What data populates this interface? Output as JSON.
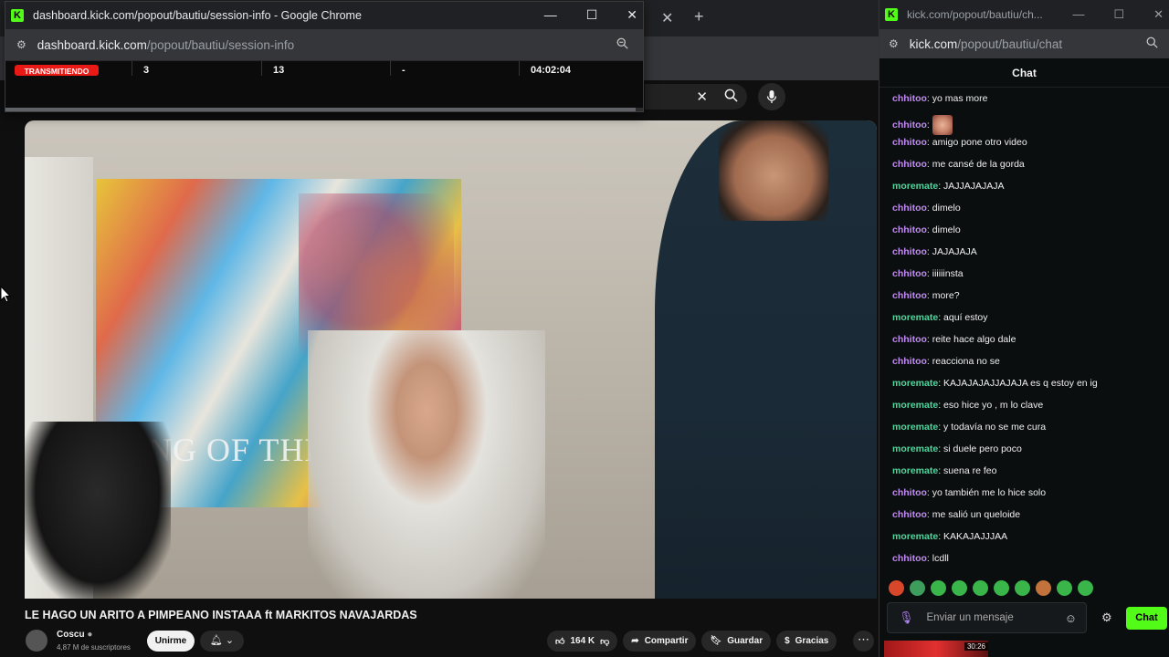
{
  "popup": {
    "title": "dashboard.kick.com/popout/bautiu/session-info - Google Chrome",
    "url_host": "dashboard.kick.com",
    "url_path": "/popout/bautiu/session-info",
    "status_badge": "TRANSMITIENDO",
    "stats": [
      "3",
      "13",
      "-",
      "04:02:04"
    ]
  },
  "chat": {
    "title": "kick.com/popout/bautiu/ch...",
    "url_host": "kick.com",
    "url_path": "/popout/bautiu/chat",
    "header": "Chat",
    "messages": [
      {
        "user": "chhitoo",
        "text": "yo mas more"
      },
      {
        "user": "chhitoo",
        "text": ""
      },
      {
        "user": "chhitoo",
        "text": "amigo pone otro video"
      },
      {
        "user": "chhitoo",
        "text": "me cansé de la gorda"
      },
      {
        "user": "moremate",
        "text": "JAJJAJAJAJA"
      },
      {
        "user": "chhitoo",
        "text": "dimelo"
      },
      {
        "user": "chhitoo",
        "text": "dimelo"
      },
      {
        "user": "chhitoo",
        "text": "JAJAJAJA"
      },
      {
        "user": "chhitoo",
        "text": "iiiiiinsta"
      },
      {
        "user": "chhitoo",
        "text": "more?"
      },
      {
        "user": "moremate",
        "text": "aquí estoy"
      },
      {
        "user": "chhitoo",
        "text": "reite hace algo dale"
      },
      {
        "user": "chhitoo",
        "text": "reacciona no se"
      },
      {
        "user": "moremate",
        "text": "KAJAJAJAJJAJAJA es q estoy en ig"
      },
      {
        "user": "moremate",
        "text": "eso hice yo , m lo clave"
      },
      {
        "user": "moremate",
        "text": "y todavía no se me cura"
      },
      {
        "user": "moremate",
        "text": "si duele pero poco"
      },
      {
        "user": "moremate",
        "text": "suena re feo"
      },
      {
        "user": "chhitoo",
        "text": "yo también me lo hice solo"
      },
      {
        "user": "chhitoo",
        "text": "me salió un queloide"
      },
      {
        "user": "moremate",
        "text": "KAKAJAJJJAA"
      },
      {
        "user": "chhitoo",
        "text": "lcdll"
      }
    ],
    "input_placeholder": "Enviar un mensaje",
    "send_label": "Chat",
    "colors": {
      "chhitoo": "#c08bf2",
      "moremate": "#4fd69c",
      "accent": "#53fc18"
    }
  },
  "youtube": {
    "video_title": "LE HAGO UN ARITO A PIMPEANO INSTAAA ft MARKITOS NAVAJARDAS",
    "channel": "Coscu",
    "subscribers": "4,87 M de suscriptores",
    "join_label": "Unirme",
    "likes": "164 K",
    "share_label": "Compartir",
    "save_label": "Guardar",
    "thanks_label": "Gracias",
    "poster_text": "KING OF THE K",
    "thumb_duration": "30:26"
  }
}
